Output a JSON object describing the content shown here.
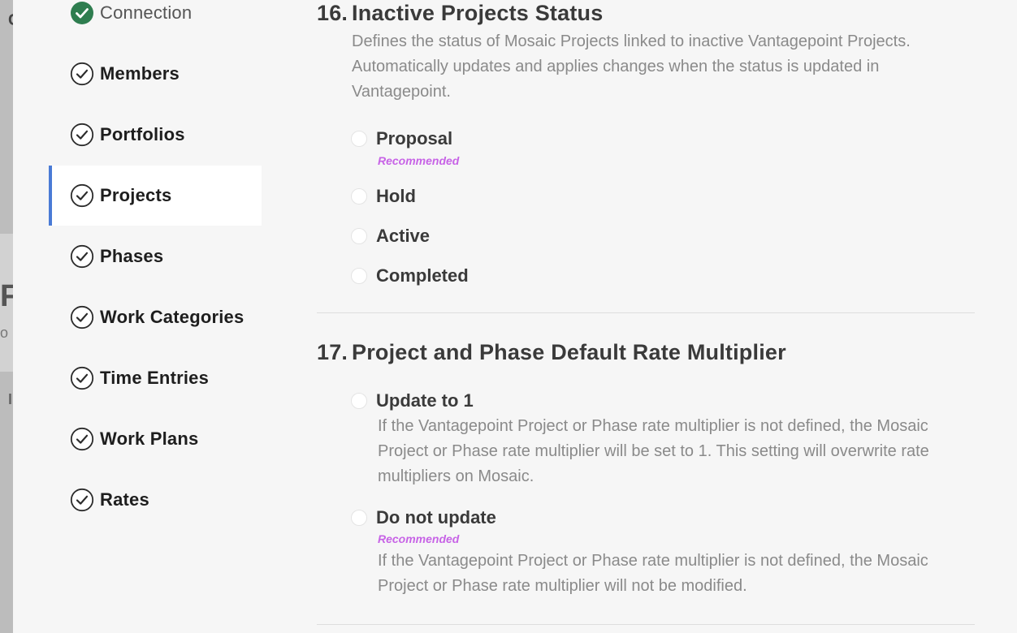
{
  "backdrop": {
    "c1": "C",
    "c2": "F",
    "c3": "o",
    "c4": "I"
  },
  "sidebar": {
    "items": [
      {
        "label": "Connection",
        "state": "complete"
      },
      {
        "label": "Members",
        "state": "check"
      },
      {
        "label": "Portfolios",
        "state": "check"
      },
      {
        "label": "Projects",
        "state": "check",
        "active": true
      },
      {
        "label": "Phases",
        "state": "check"
      },
      {
        "label": "Work Categories",
        "state": "check"
      },
      {
        "label": "Time Entries",
        "state": "check"
      },
      {
        "label": "Work Plans",
        "state": "check"
      },
      {
        "label": "Rates",
        "state": "check"
      }
    ]
  },
  "section16": {
    "number": "16.",
    "title": "Inactive Projects Status",
    "description": "Defines the status of Mosaic Projects linked to inactive Vantagepoint Projects. Automatically updates and applies changes when the status is updated in Vantagepoint.",
    "options": [
      {
        "label": "Proposal",
        "badge": "Recommended"
      },
      {
        "label": "Hold"
      },
      {
        "label": "Active"
      },
      {
        "label": "Completed"
      }
    ]
  },
  "section17": {
    "number": "17.",
    "title": "Project and Phase Default Rate Multiplier",
    "options": [
      {
        "label": "Update to 1",
        "description": "If the Vantagepoint Project or Phase rate multiplier is not defined, the Mosaic Project or Phase rate multiplier will be set to 1. This setting will overwrite rate multipliers on Mosaic."
      },
      {
        "label": "Do not update",
        "badge": "Recommended",
        "description": "If the Vantagepoint Project or Phase rate multiplier is not defined, the Mosaic Project or Phase rate multiplier will not be modified."
      }
    ]
  },
  "colors": {
    "accent": "#4a7bd6",
    "complete": "#2e7d4f",
    "badge": "#c763e6"
  }
}
